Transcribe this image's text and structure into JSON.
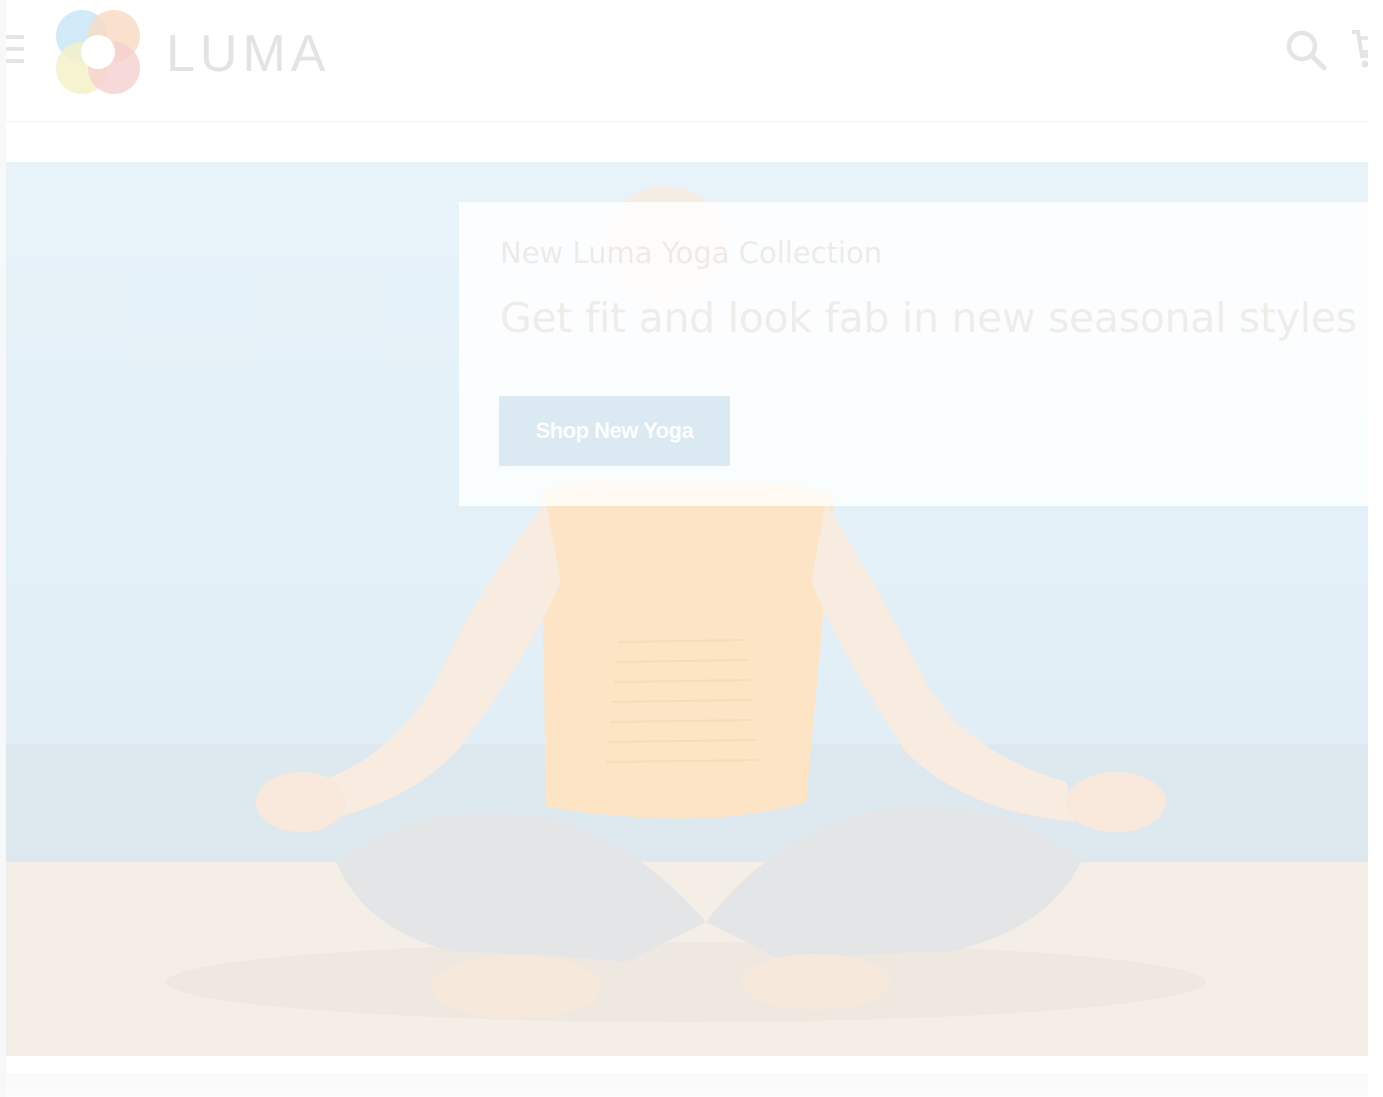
{
  "header": {
    "logo_text": "LUMA",
    "icons": {
      "menu": "hamburger-menu-icon",
      "search": "search-icon",
      "cart": "cart-icon"
    }
  },
  "hero": {
    "kicker": "New Luma Yoga Collection",
    "headline": "Get fit and look fab in new seasonal styles",
    "button_label": "Shop New Yoga"
  },
  "colors": {
    "logo_blue": "#cfe9f7",
    "logo_orange": "#f8d7c0",
    "logo_yellow": "#f5f0c6",
    "logo_red": "#f6cccc",
    "button_bg": "#dbe9f3",
    "sky": "#e3f0f8",
    "sand": "#f5efe8"
  }
}
